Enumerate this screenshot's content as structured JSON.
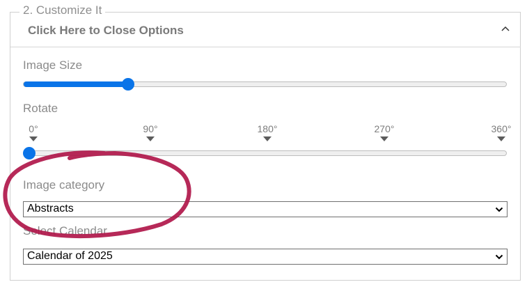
{
  "section": {
    "legend": "2. Customize It",
    "toggle_label": "Click Here to Close Options"
  },
  "image_size": {
    "label": "Image Size",
    "value_fraction": 0.21
  },
  "rotate": {
    "label": "Rotate",
    "value_degrees": 0,
    "ticks": [
      "0°",
      "90°",
      "180°",
      "270°",
      "360°"
    ]
  },
  "image_category": {
    "label": "Image category",
    "selected": "Abstracts"
  },
  "calendar": {
    "label": "Select Calendar",
    "selected": "Calendar of 2025"
  },
  "colors": {
    "accent": "#0a74e8",
    "annotation": "#b0174a"
  },
  "icons": {
    "toggle": "chevron-up-icon",
    "select": "chevron-down-icon"
  }
}
